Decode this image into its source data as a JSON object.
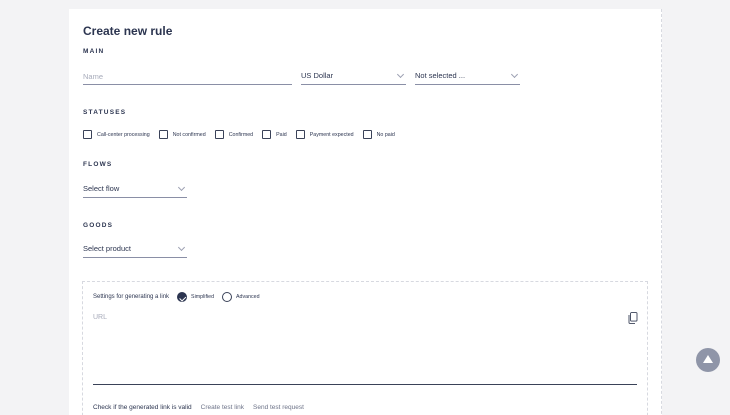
{
  "page": {
    "title": "Create new rule"
  },
  "main": {
    "section_label": "MAIN",
    "name_placeholder": "Name",
    "currency_value": "US Dollar",
    "third_select_value": "Not selected ..."
  },
  "statuses": {
    "section_label": "STATUSES",
    "items": [
      {
        "label": "Call-center processing",
        "checked": false
      },
      {
        "label": "Not confirmed",
        "checked": false
      },
      {
        "label": "Confirmed",
        "checked": false
      },
      {
        "label": "Paid",
        "checked": false
      },
      {
        "label": "Payment expected",
        "checked": false
      },
      {
        "label": "No paid",
        "checked": false
      }
    ]
  },
  "flows": {
    "section_label": "FLOWS",
    "select_value": "Select flow"
  },
  "goods": {
    "section_label": "GOODS",
    "select_value": "Select product"
  },
  "link_settings": {
    "label": "Settings for generating a link",
    "options": [
      {
        "label": "Simplified",
        "selected": true
      },
      {
        "label": "Advanced",
        "selected": false
      }
    ],
    "url_placeholder": "URL",
    "copy_icon": "copy-icon",
    "check_label": "Check if the generated link is valid",
    "create_test_link": "Create test link",
    "send_test_request": "Send test request"
  },
  "fab_icon": "arrow-up-icon"
}
